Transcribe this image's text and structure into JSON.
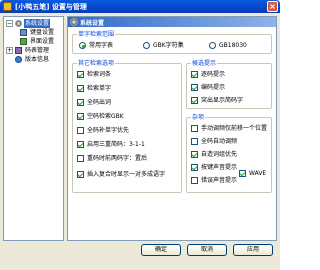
{
  "window": {
    "title": "[小鸭五笔] 设置与管理",
    "close_label": "×"
  },
  "tree": {
    "items": [
      {
        "label": "系统设置",
        "icon": "gear-icon"
      },
      {
        "label": "键盘设置",
        "icon": "keyboard-icon"
      },
      {
        "label": "界面设置",
        "icon": "ui-icon"
      },
      {
        "label": "码表管理",
        "icon": "dictionary-icon"
      },
      {
        "label": "版本信息",
        "icon": "info-icon"
      }
    ],
    "expander": "−",
    "expander2": "+"
  },
  "panel": {
    "header": "系统设置",
    "charset": {
      "title": "单字检索范围",
      "options": [
        "常用字表",
        "GBK字符集",
        "GB18030"
      ],
      "selected": "常用字表"
    },
    "other": {
      "title": "其它检索选项",
      "options": [
        {
          "label": "检索词条",
          "checked": true
        },
        {
          "label": "检索单字",
          "checked": true
        },
        {
          "label": "全码出词",
          "checked": true
        },
        {
          "label": "空码检索GBK",
          "checked": true
        },
        {
          "label": "全码补单字优先",
          "checked": false
        },
        {
          "label": "启用三重简码：3-1-1",
          "checked": true
        },
        {
          "label": "重码时前两码字：置后",
          "checked": false
        },
        {
          "label": "插入复合时显示一对多成语字",
          "checked": true
        }
      ]
    },
    "candidate": {
      "title": "候选提示",
      "options": [
        {
          "label": "逐码提示",
          "checked": true
        },
        {
          "label": "编码提示",
          "checked": true
        },
        {
          "label": "突出显示简码字",
          "checked": true
        }
      ]
    },
    "misc": {
      "title": "杂项",
      "options": [
        {
          "label": "手动调频仅前移一个位置",
          "checked": false
        },
        {
          "label": "全码自动调频",
          "checked": false
        },
        {
          "label": "自造词组优先",
          "checked": true
        },
        {
          "label": "按键声音提示",
          "checked": true
        },
        {
          "label": "错误声音提示",
          "checked": false
        }
      ],
      "wave_label": "WAVE",
      "wave_checked": true
    }
  },
  "buttons": {
    "ok": "确定",
    "cancel": "取消",
    "apply": "应用"
  }
}
